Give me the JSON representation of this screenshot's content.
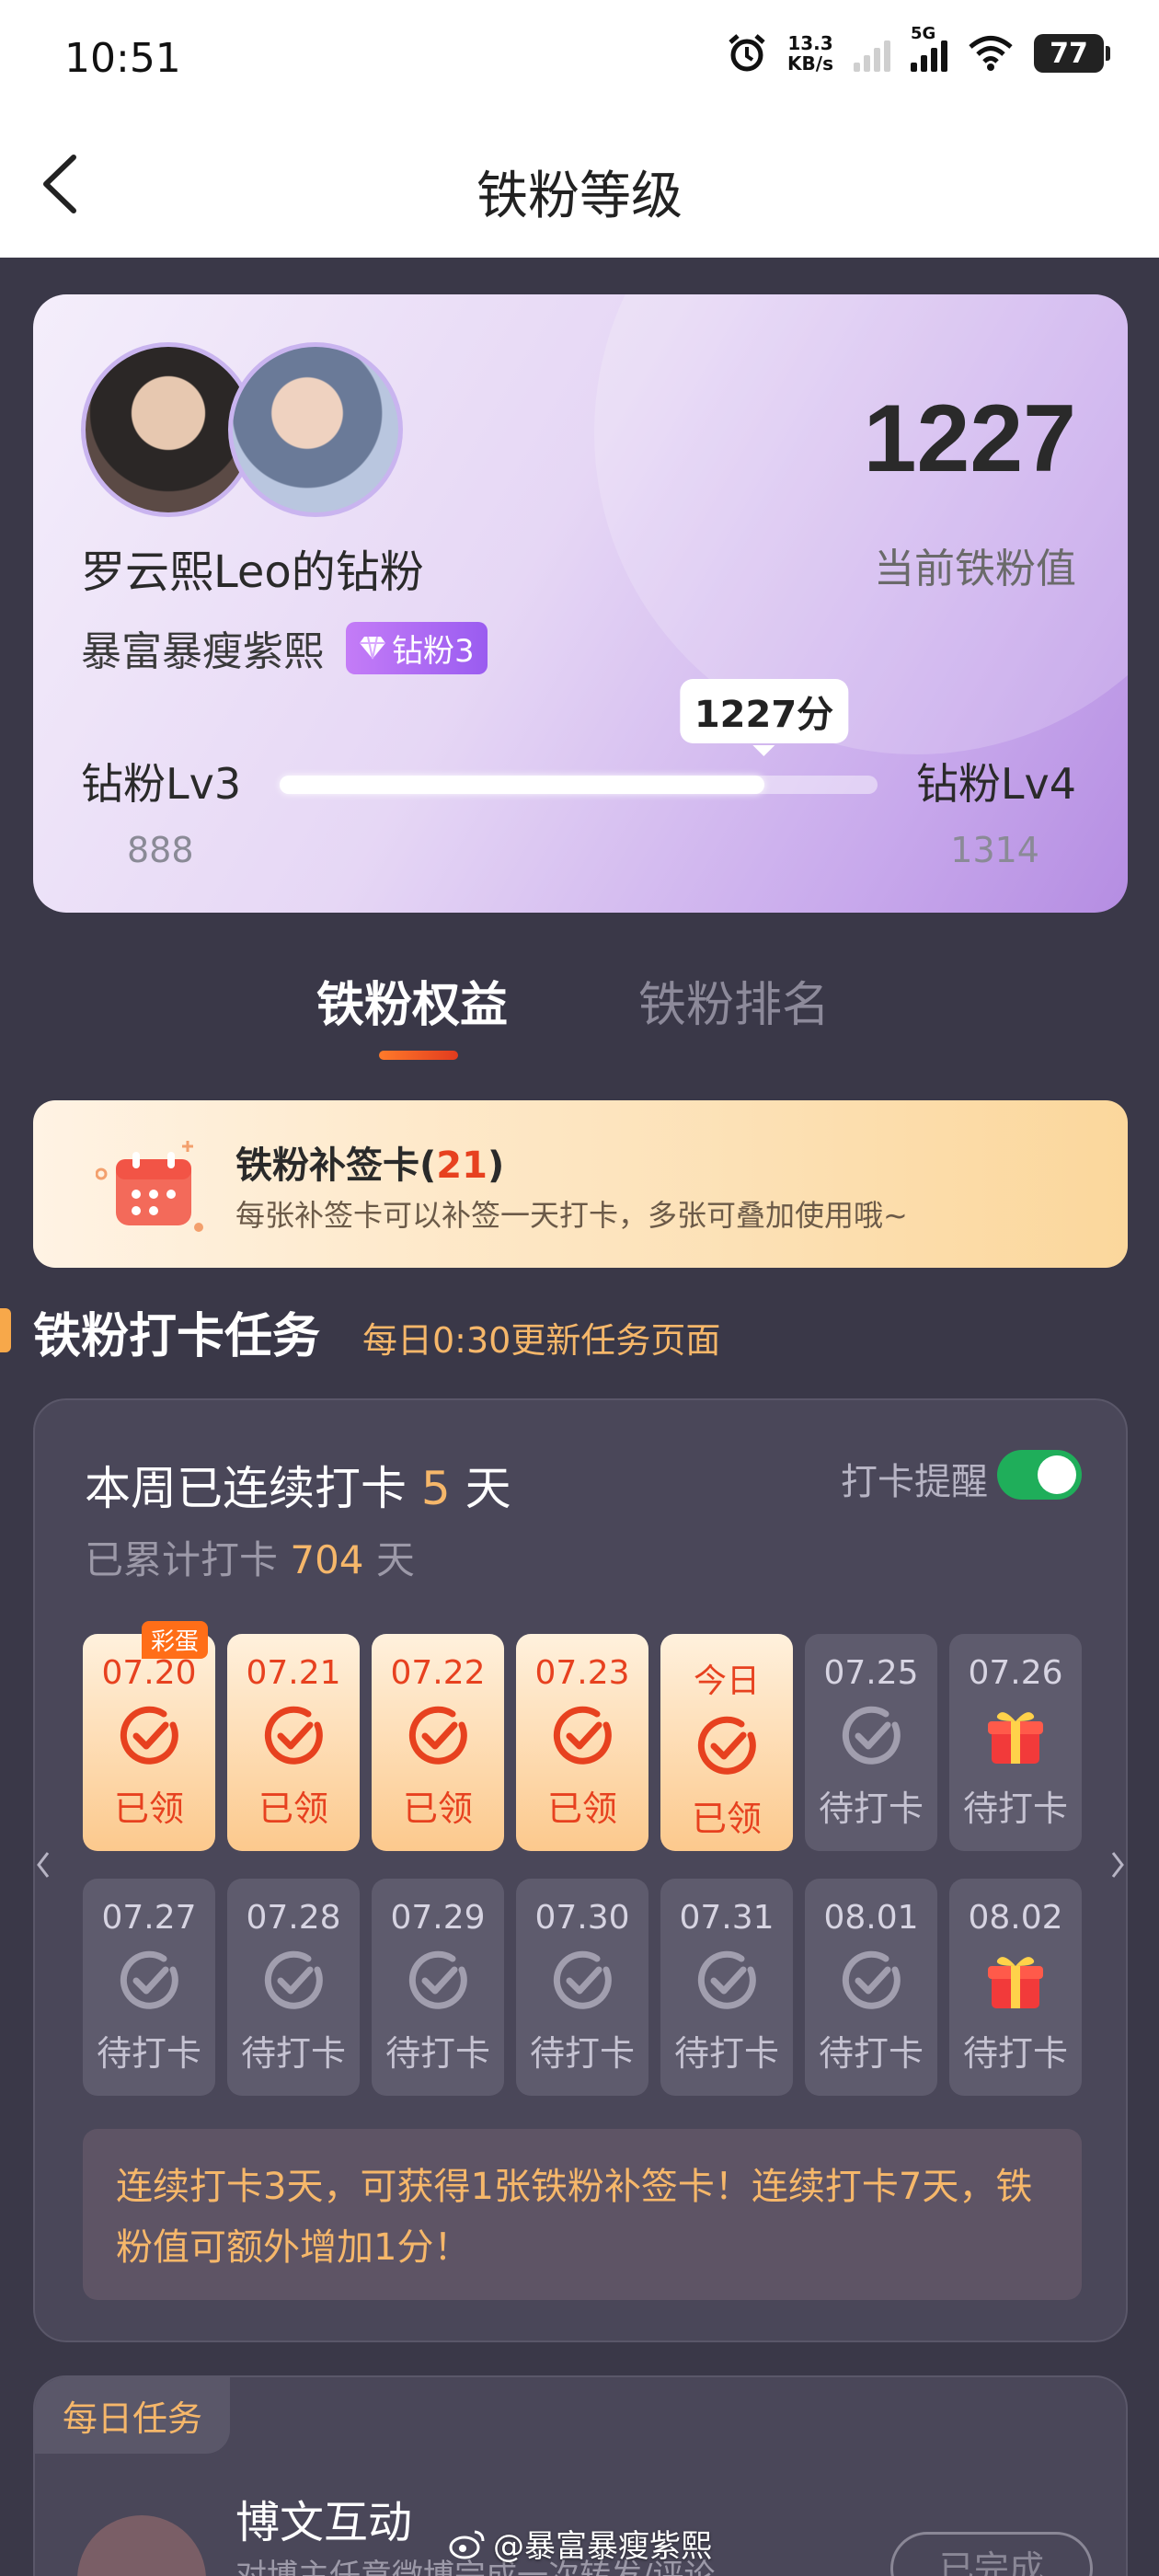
{
  "status_bar": {
    "time": "10:51",
    "speed_top": "13.3",
    "speed_unit": "KB/s",
    "network": "5G",
    "battery": "77"
  },
  "nav": {
    "title": "铁粉等级"
  },
  "header": {
    "fan_name": "罗云熙Leo的钻粉",
    "user_name": "暴富暴瘦紫熙",
    "badge": "钻粉3",
    "score": "1227",
    "score_label": "当前铁粉值",
    "level_left": "钻粉Lv3",
    "level_right": "钻粉Lv4",
    "min_value": "888",
    "max_value": "1314",
    "bubble": "1227分",
    "progress": 0.81
  },
  "tabs": [
    {
      "label": "铁粉权益"
    },
    {
      "label": "铁粉排名"
    }
  ],
  "makeup_card": {
    "title": "铁粉补签卡(",
    "count": "21",
    "close": ")",
    "desc": "每张补签卡可以补签一天打卡，多张可叠加使用哦~"
  },
  "section": {
    "title": "铁粉打卡任务",
    "subtitle": "每日0:30更新任务页面"
  },
  "checkin": {
    "streak_prefix": "本周已连续打卡 ",
    "streak_days": "5",
    "streak_suffix": " 天",
    "total_prefix": "已累计打卡 ",
    "total_days": "704",
    "total_suffix": " 天",
    "reminder_label": "打卡提醒",
    "reminder_on": true,
    "egg_label": "彩蛋",
    "days": [
      {
        "date": "07.20",
        "status": "已领",
        "state": "done"
      },
      {
        "date": "07.21",
        "status": "已领",
        "state": "done"
      },
      {
        "date": "07.22",
        "status": "已领",
        "state": "done"
      },
      {
        "date": "07.23",
        "status": "已领",
        "state": "done"
      },
      {
        "date": "今日",
        "status": "已领",
        "state": "done"
      },
      {
        "date": "07.25",
        "status": "待打卡",
        "state": "todo"
      },
      {
        "date": "07.26",
        "status": "待打卡",
        "state": "gift"
      },
      {
        "date": "07.27",
        "status": "待打卡",
        "state": "todo"
      },
      {
        "date": "07.28",
        "status": "待打卡",
        "state": "todo"
      },
      {
        "date": "07.29",
        "status": "待打卡",
        "state": "todo"
      },
      {
        "date": "07.30",
        "status": "待打卡",
        "state": "todo"
      },
      {
        "date": "07.31",
        "status": "待打卡",
        "state": "todo"
      },
      {
        "date": "08.01",
        "status": "待打卡",
        "state": "todo"
      },
      {
        "date": "08.02",
        "status": "待打卡",
        "state": "gift"
      }
    ],
    "tip": "连续打卡3天，可获得1张铁粉补签卡！连续打卡7天，铁粉值可额外增加1分！"
  },
  "daily": {
    "tag": "每日任务",
    "task_title": "博文互动",
    "task_desc": "对博主任意微博完成一次转发/评论",
    "button": "已完成"
  },
  "watermark": "@暴富暴瘦紫熙",
  "colors": {
    "accent": "#e7411f",
    "gold": "#f6b76a",
    "background": "#3a3848",
    "toggle": "#1fae5a"
  }
}
